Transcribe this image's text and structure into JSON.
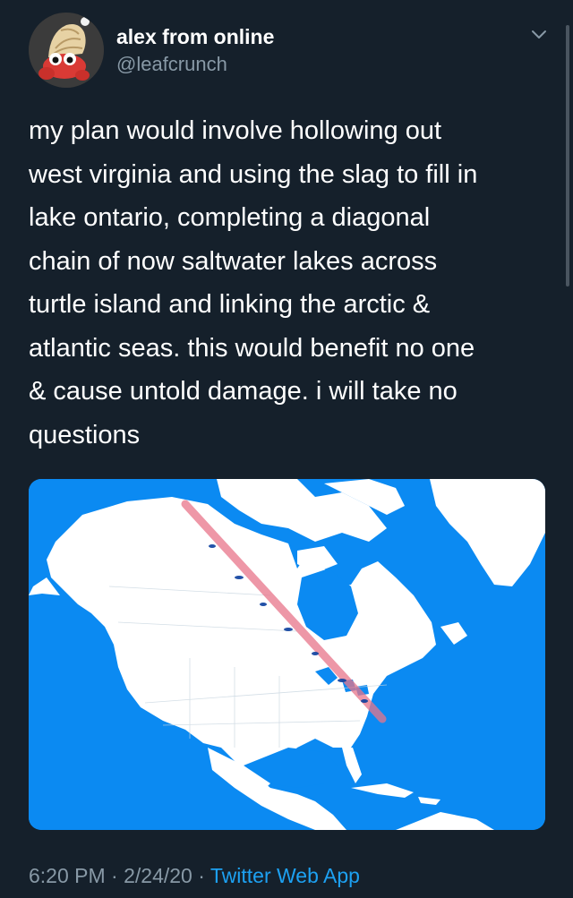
{
  "user": {
    "display_name": "alex from online",
    "handle": "@leafcrunch",
    "avatar": "hermit-crab-avatar"
  },
  "tweet": {
    "lines": [
      "my plan would involve hollowing out",
      "west virginia and using the slag to fill in",
      "lake ontario, completing a diagonal",
      "chain of now saltwater lakes across",
      "turtle island and linking the arctic &",
      "atlantic seas. this would benefit no one",
      "& cause untold damage. i will take no",
      "questions"
    ],
    "media": {
      "type": "map",
      "subject": "North America",
      "ocean_color": "#0b8af2",
      "land_color": "#ffffff",
      "line_color": "#e8758a"
    },
    "time": "6:20 PM",
    "date": "2/24/20",
    "source": "Twitter Web App"
  },
  "icons": {
    "menu": "chevron-down-icon"
  },
  "colors": {
    "background": "#15202b",
    "secondary_text": "#8899a6",
    "link": "#1da1f2"
  }
}
